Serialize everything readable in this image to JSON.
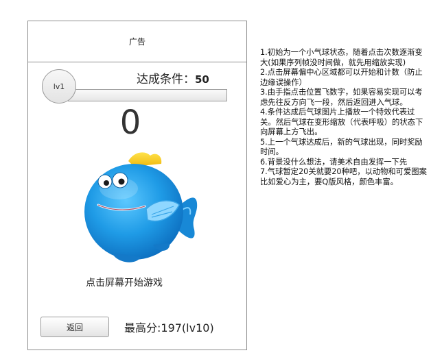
{
  "ad": {
    "label": "广告"
  },
  "level": {
    "label": "lv1",
    "progress": 0
  },
  "goal": {
    "label": "达成条件：",
    "value": "50"
  },
  "counter": {
    "value": "0"
  },
  "mascot": {
    "icon": "blue-fish-balloon",
    "body_color": "#1a93e0",
    "fin_color": "#f6d21a"
  },
  "start_prompt": "点击屏幕开始游戏",
  "back_button": {
    "label": "返回"
  },
  "high_score": {
    "label": "最高分:197(lv10)"
  },
  "notes": [
    "1.初始为一个小气球状态，随着点击次数逐渐变大(如果序列帧没时间做，就先用缩放实现)",
    "2.点击屏幕偏中心区域都可以开始和计数（防止边缘误操作）",
    "3.由手指点击位置飞数字，如果容易实现可以考虑先往反方向飞一段，然后返回进入气球。",
    "4.条件达成后气球图片上播放一个特效代表过关。然后气球在变形缩放（代表呼吸）的状态下向屏幕上方飞出。",
    "5.上一个气球达成后，新的气球出现，同时奖励时间。",
    "6.背景没什么想法，请美术自由发挥一下先",
    "7.气球暂定20关就要20种吧，以动物和可爱图案比如爱心为主，要Q版风格，颜色丰富。"
  ]
}
